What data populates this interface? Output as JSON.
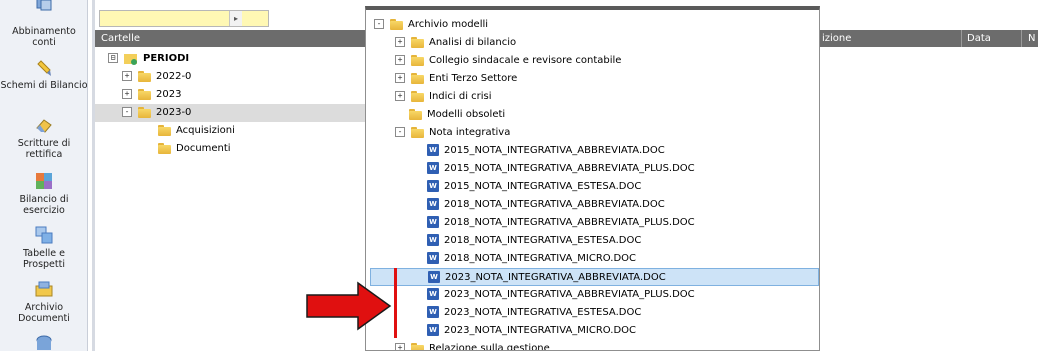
{
  "left_nav": {
    "items": [
      {
        "label": "Abbinamento conti",
        "icon": "link-accounts-icon"
      },
      {
        "label": "Schemi di Bilancio",
        "icon": "pencil-icon"
      },
      {
        "label": "Scritture di rettifica",
        "icon": "eraser-icon"
      },
      {
        "label": "Bilancio di esercizio",
        "icon": "chart-grid-icon"
      },
      {
        "label": "Tabelle e Prospetti",
        "icon": "tables-icon"
      },
      {
        "label": "Archivio Documenti",
        "icon": "document-archive-icon"
      }
    ]
  },
  "cartelle": {
    "search_value": "",
    "header": "Cartelle",
    "tree": [
      {
        "label": "PERIODI",
        "exp": "⊟"
      },
      {
        "label": "2022-0",
        "exp": "+"
      },
      {
        "label": "2023",
        "exp": "+"
      },
      {
        "label": "2023-0",
        "exp": "-"
      },
      {
        "label": "Acquisizioni"
      },
      {
        "label": "Documenti"
      }
    ]
  },
  "popup": {
    "rows": [
      {
        "label": "Archivio modelli",
        "exp": "-"
      },
      {
        "label": "Analisi di bilancio",
        "exp": "+"
      },
      {
        "label": "Collegio sindacale e revisore contabile",
        "exp": "+"
      },
      {
        "label": "Enti Terzo Settore",
        "exp": "+"
      },
      {
        "label": "Indici di crisi",
        "exp": "+"
      },
      {
        "label": "Modelli obsoleti"
      },
      {
        "label": "Nota integrativa",
        "exp": "-"
      },
      {
        "label": "2015_NOTA_INTEGRATIVA_ABBREVIATA.DOC"
      },
      {
        "label": "2015_NOTA_INTEGRATIVA_ABBREVIATA_PLUS.DOC"
      },
      {
        "label": "2015_NOTA_INTEGRATIVA_ESTESA.DOC"
      },
      {
        "label": "2018_NOTA_INTEGRATIVA_ABBREVIATA.DOC"
      },
      {
        "label": "2018_NOTA_INTEGRATIVA_ABBREVIATA_PLUS.DOC"
      },
      {
        "label": "2018_NOTA_INTEGRATIVA_ESTESA.DOC"
      },
      {
        "label": "2018_NOTA_INTEGRATIVA_MICRO.DOC"
      },
      {
        "label": "2023_NOTA_INTEGRATIVA_ABBREVIATA.DOC"
      },
      {
        "label": "2023_NOTA_INTEGRATIVA_ABBREVIATA_PLUS.DOC"
      },
      {
        "label": "2023_NOTA_INTEGRATIVA_ESTESA.DOC"
      },
      {
        "label": "2023_NOTA_INTEGRATIVA_MICRO.DOC"
      },
      {
        "label": "Relazione sulla gestione",
        "exp": "+"
      }
    ]
  },
  "right_panel": {
    "columns": [
      "izione",
      "Data",
      "N"
    ]
  },
  "annotation": {
    "arrow_color": "#e01010"
  }
}
